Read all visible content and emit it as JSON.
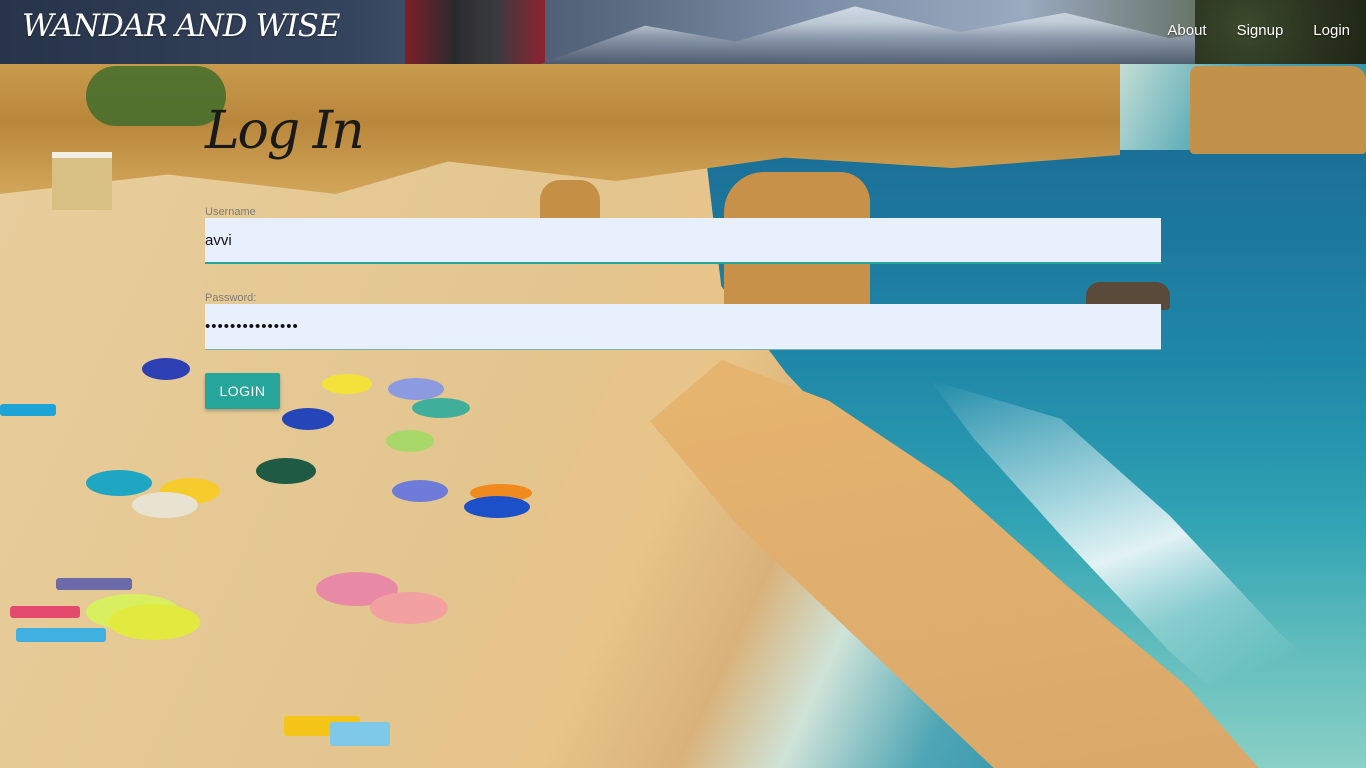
{
  "brand": "WANDAR AND WISE",
  "nav": {
    "about": "About",
    "signup": "Signup",
    "login": "Login"
  },
  "form": {
    "title": "Log In",
    "username_label": "Username",
    "username_value": "avvi",
    "password_label": "Password:",
    "password_value": "•••••••••••••••",
    "submit": "LOGIN"
  },
  "colors": {
    "accent": "#26a69a",
    "input_bg": "#e8f0fe"
  }
}
